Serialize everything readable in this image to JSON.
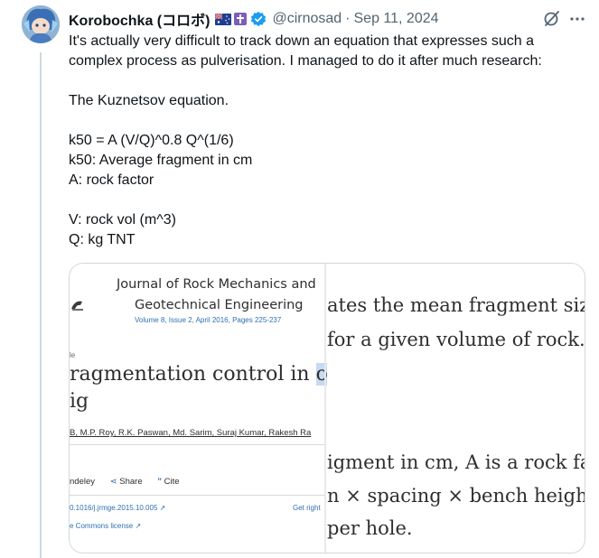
{
  "tweet": {
    "display_name": "Korobochka (コロボ)",
    "handle": "@cirnosad",
    "separator": "·",
    "date": "Sep 11, 2024",
    "text": "It's actually very difficult to track down an equation that expresses such a complex process as pulverisation. I managed to do it after much research:\n\nThe Kuznetsov equation.\n\nk50 = A (V/Q)^0.8 Q^(1/6)\nk50: Average fragment in cm\nA: rock factor\n\nV: rock vol (m^3)\nQ: kg TNT"
  },
  "icons": {
    "flag": "australia-flag-icon",
    "cross": "cross-badge-icon",
    "verified": "verified-badge-icon",
    "grok": "grok-icon",
    "more": "more-icon"
  },
  "colors": {
    "verified": "#1d9bf0",
    "link": "#2f6fb1",
    "highlight": "#c6daf0"
  },
  "media": {
    "journal_line1": "Journal of Rock Mechanics and",
    "journal_line2": "Geotechnical Engineering",
    "volume": "Volume 8, Issue 2, April 2016, Pages 225-237",
    "small_e": "le",
    "title_pre": "ragmentation control in ",
    "title_hl": "ope",
    "title_line2": "ig",
    "authors": "B, M.P. Roy, R.K. Paswan, Md. Sarim, Suraj Kumar, Rakesh Ra",
    "actions": [
      "ndeley",
      "Share",
      "Cite"
    ],
    "doi": "0.1016/j.jrmge.2015.10.005 ↗",
    "get_rights": "Get right",
    "license": "e Commons license ↗",
    "right_lines": [
      "ates the mean fragment size",
      "for a given volume of rock. T",
      "igment in cm, A is a rock fact",
      "n × spacing × bench height),",
      "per hole."
    ]
  }
}
